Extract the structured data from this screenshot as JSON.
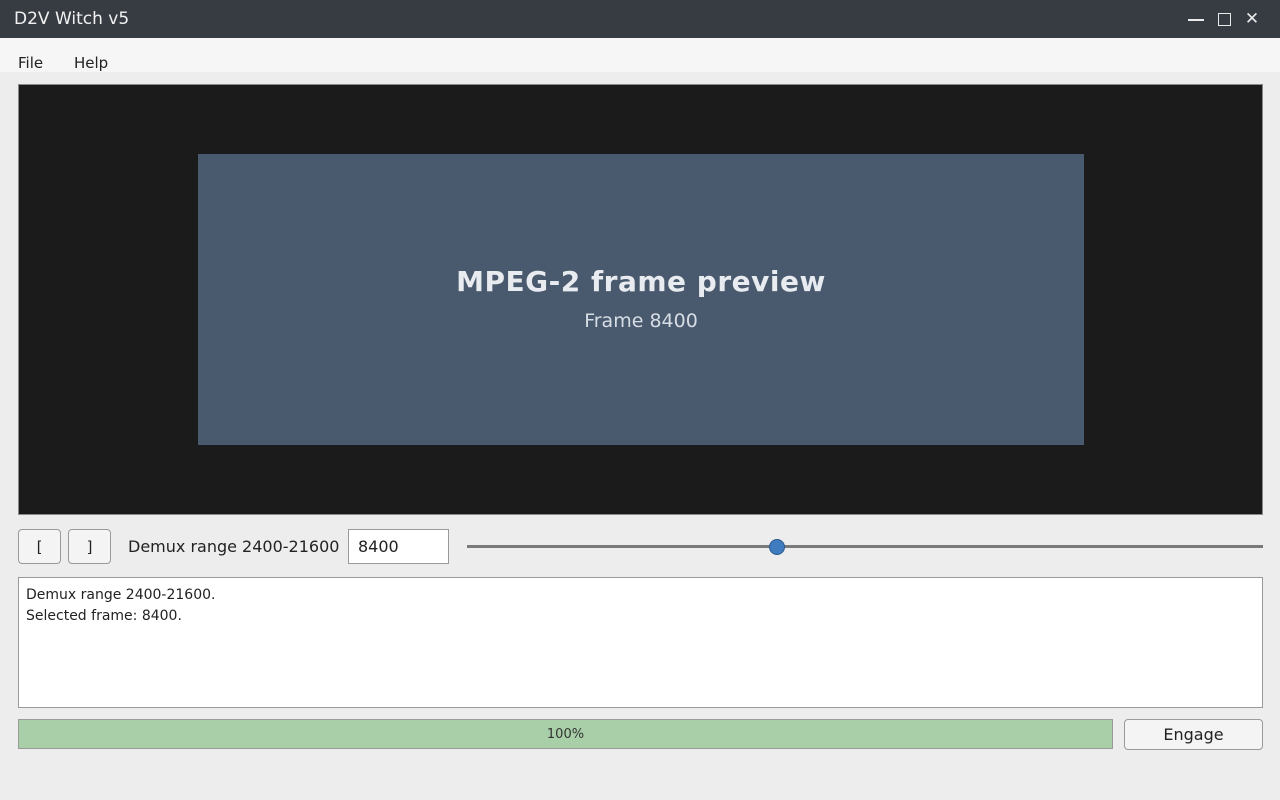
{
  "window": {
    "title": "D2V Witch v5",
    "controls": {
      "minimize_icon": "minimize-icon",
      "maximize_icon": "maximize-icon",
      "close_icon": "close-icon",
      "close_glyph": "✕"
    }
  },
  "menubar": {
    "items": [
      {
        "label": "File"
      },
      {
        "label": "Help"
      }
    ]
  },
  "preview": {
    "title": "MPEG-2 frame preview",
    "subtitle": "Frame 8400"
  },
  "controls": {
    "range_start_label": "[",
    "range_end_label": "]",
    "range_label": "Demux range 2400-21600",
    "frame_value": "8400",
    "slider": {
      "min": 0,
      "max": 21600,
      "value": 8400
    }
  },
  "log": {
    "lines": [
      "Demux range 2400-21600.",
      "Selected frame: 8400."
    ]
  },
  "progress": {
    "value": 100,
    "text": "100%"
  },
  "engage_label": "Engage",
  "colors": {
    "titlebar": "#373c43",
    "preview_bg": "#1b1b1b",
    "frame_bg": "#4a5a6e",
    "slider_handle": "#3f7bbf",
    "progress_fill": "#a8cfa8"
  }
}
